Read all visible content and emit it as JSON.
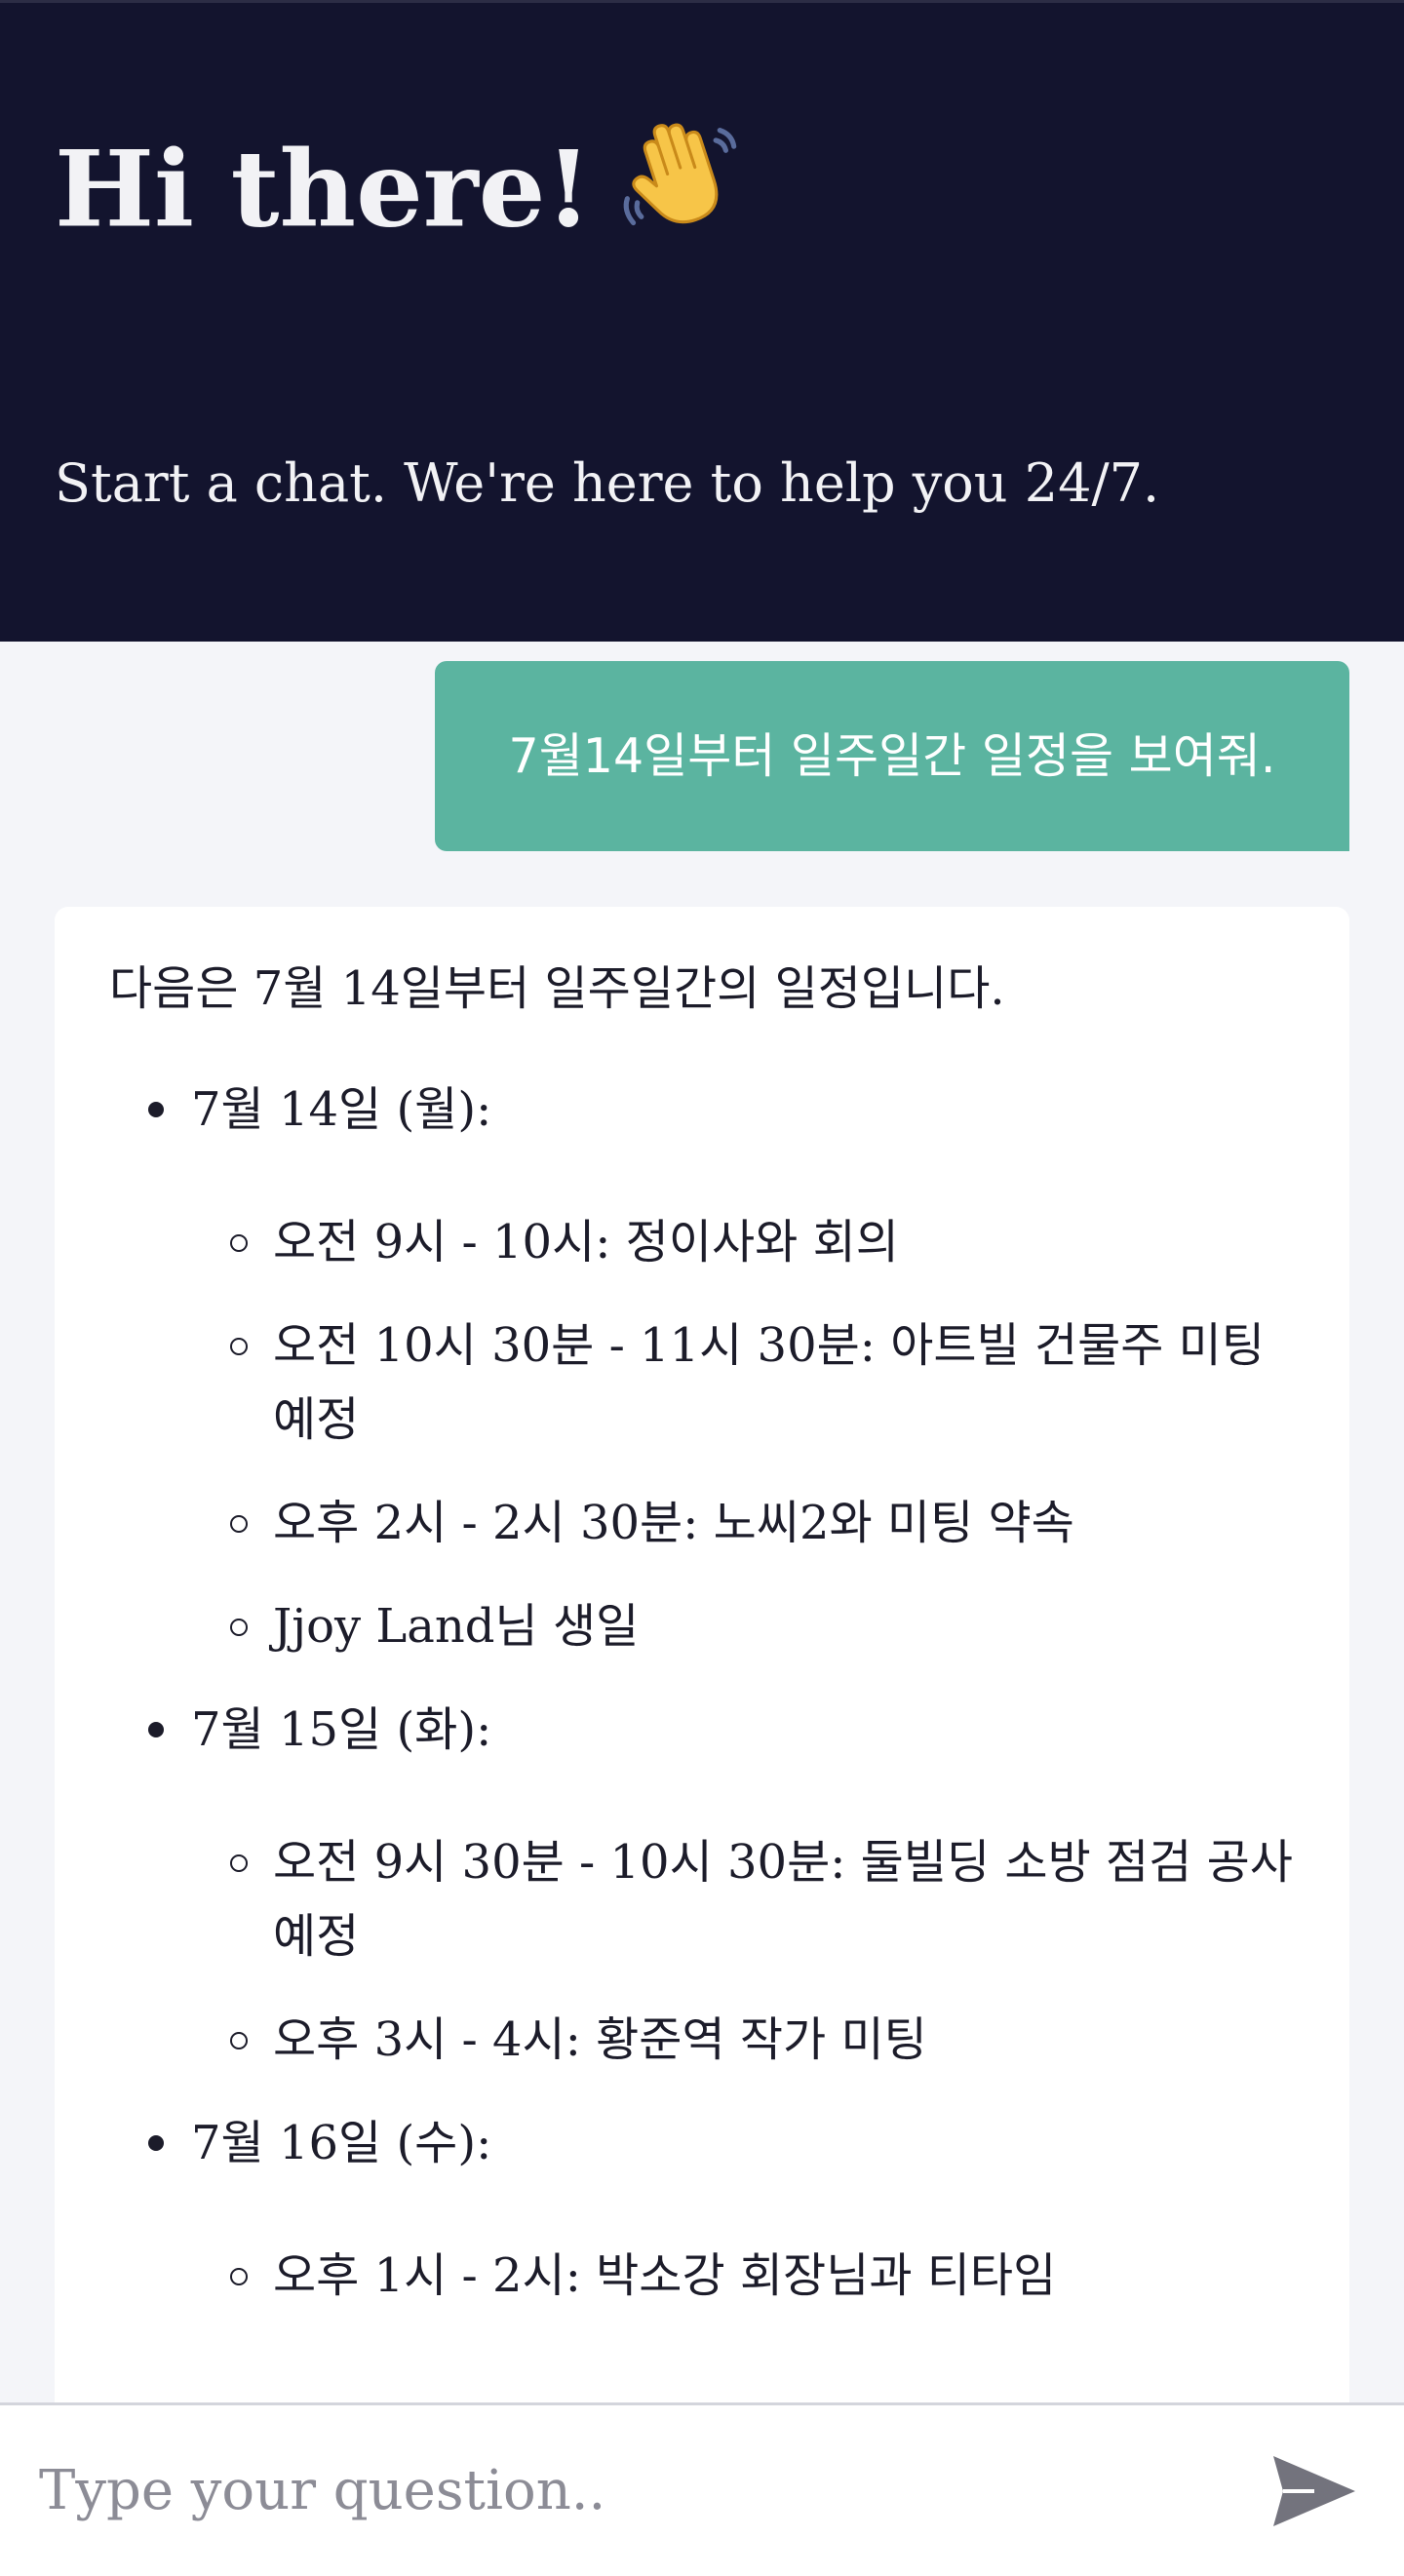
{
  "header": {
    "title": "Hi there!",
    "wave_icon": "waving-hand-icon",
    "subtitle": "Start a chat. We're here to help you 24/7."
  },
  "chat": {
    "user_message": "7월14일부터 일주일간 일정을 보여줘.",
    "bot_message": {
      "intro": "다음은 7월 14일부터 일주일간의 일정입니다.",
      "days": [
        {
          "label": "7월 14일 (월):",
          "events": [
            "오전 9시 - 10시: 정이사와 회의",
            "오전 10시 30분 - 11시 30분: 아트빌 건물주 미팅예정",
            "오후 2시 - 2시 30분: 노씨2와 미팅 약속",
            "Jjoy Land님 생일"
          ]
        },
        {
          "label": "7월 15일 (화):",
          "events": [
            "오전 9시 30분 - 10시 30분: 둘빌딩 소방 점검 공사 예정",
            "오후 3시 - 4시: 황준역 작가 미팅"
          ]
        },
        {
          "label": "7월 16일 (수):",
          "events": [
            "오후 1시 - 2시: 박소강 회장님과 티타임"
          ]
        }
      ]
    }
  },
  "input": {
    "placeholder": "Type your question..",
    "send_icon": "send-arrow-icon"
  },
  "colors": {
    "header_bg": "#13142e",
    "user_bubble": "#5bb4a0",
    "page_bg": "#f4f5f9",
    "send_icon": "#73737d"
  }
}
